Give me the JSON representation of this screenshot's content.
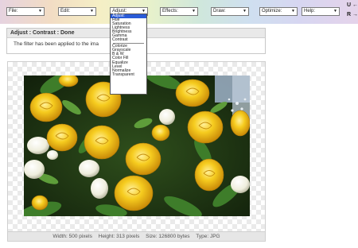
{
  "toolbar": {
    "menus": [
      {
        "label": "File:"
      },
      {
        "label": "Edit:"
      },
      {
        "label": "Adjust:"
      },
      {
        "label": "Effects:"
      },
      {
        "label": "Draw:"
      },
      {
        "label": "Optimize:"
      },
      {
        "label": "Help:"
      }
    ],
    "undo": "U ←",
    "redo": "R →"
  },
  "adjust_dropdown": {
    "selected": "Adjust:",
    "group1": [
      "Hue",
      "Saturation",
      "Lightness",
      "Brightness",
      "Gamma",
      "Contrast"
    ],
    "group2": [
      "Colorize",
      "Grayscale",
      "B & W",
      "Color Fill",
      "Equalize",
      "Level",
      "Normalize",
      "Transparent"
    ]
  },
  "status": {
    "title": "Adjust : Contrast : Done",
    "message": "The filter has been applied to the ima"
  },
  "image_info": {
    "width": "Width: 500 pixels",
    "height": "Height: 313 pixels",
    "size": "Size: 126800 bytes",
    "type": "Type: JPG"
  },
  "colors": {
    "photo_background": "#2d4a1e",
    "flower_yellow": "#f2c21a",
    "flower_white": "#f7f4e6",
    "leaf_green": "#3e7d2a",
    "dropdown_highlight": "#2a5bd7"
  }
}
